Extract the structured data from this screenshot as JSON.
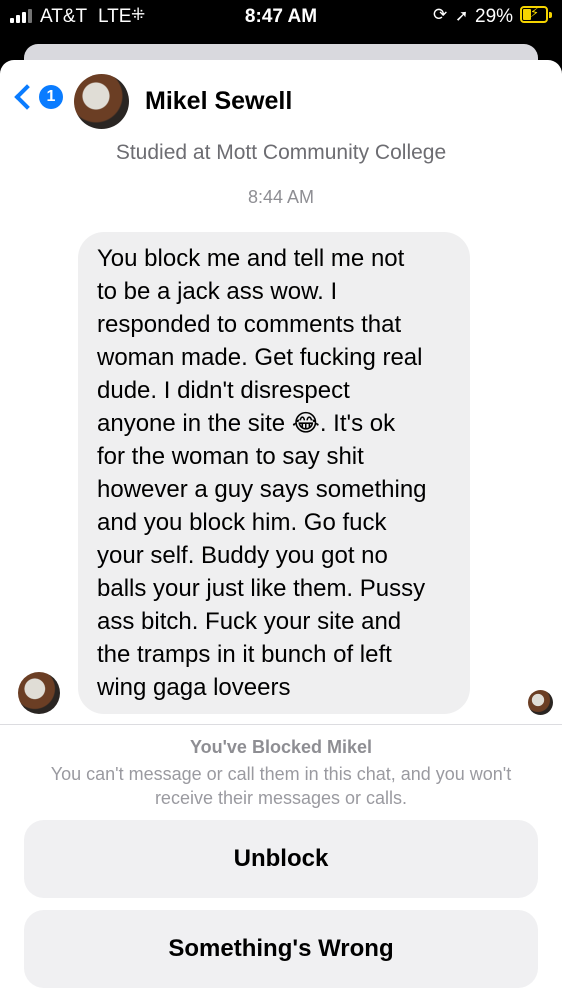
{
  "status_bar": {
    "carrier": "AT&T",
    "network": "LTE",
    "time": "8:47 AM",
    "battery": "29%"
  },
  "header": {
    "unread_count": "1",
    "contact_name": "Mikel Sewell",
    "subtitle": "Studied at Mott Community College"
  },
  "conversation": {
    "timestamp": "8:44 AM",
    "message_lines": [
      "You block me and tell me not",
      "to be a jack ass wow. I",
      "responded to comments that",
      "woman made. Get fucking real",
      "dude. I didn't disrespect",
      "anyone in the site 😂. It's ok",
      "for the woman to say shit",
      "however a guy says something",
      "and you block him. Go fuck",
      "your self. Buddy you got no",
      "balls your just like them. Pussy",
      "ass bitch. Fuck your site and",
      "the tramps in it bunch of left",
      "wing gaga loveers"
    ]
  },
  "blocked_notice": {
    "title": "You've Blocked Mikel",
    "description": "You can't message or call them in this chat, and you won't receive their messages or calls."
  },
  "actions": {
    "unblock_label": "Unblock",
    "something_wrong_label": "Something's Wrong"
  },
  "colors": {
    "accent": "#0a7cff",
    "bubble_bg": "#efeff0",
    "battery": "#f5d400"
  }
}
